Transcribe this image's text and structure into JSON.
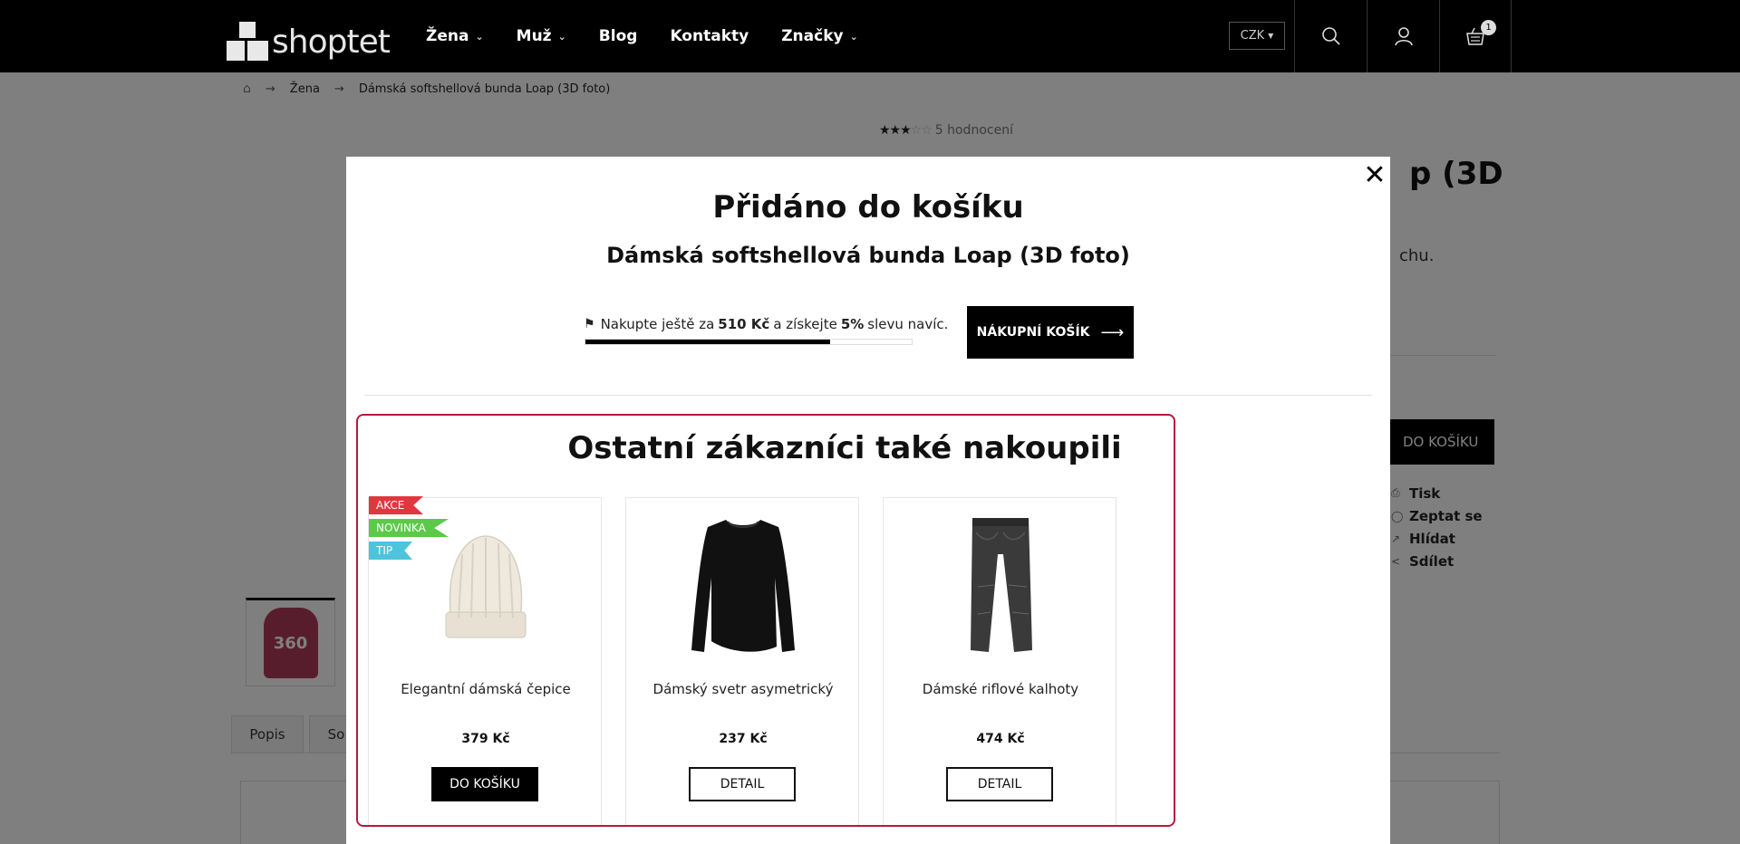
{
  "header": {
    "logo_text": "shoptet",
    "nav": [
      {
        "label": "Žena",
        "dropdown": true
      },
      {
        "label": "Muž",
        "dropdown": true
      },
      {
        "label": "Blog",
        "dropdown": false
      },
      {
        "label": "Kontakty",
        "dropdown": false
      },
      {
        "label": "Značky",
        "dropdown": true
      }
    ],
    "currency": "CZK",
    "cart_count": "1"
  },
  "breadcrumb": {
    "home_icon": "home-icon",
    "items": [
      "Žena",
      "Dámská softshellová bunda Loap (3D foto)"
    ]
  },
  "product": {
    "rating_text": "5 hodnocení",
    "rating_value": 3,
    "rating_max": 5,
    "title_fragment": "p (3D",
    "text_fragment": "chu.",
    "buy_label": "DO KOŠÍKU",
    "thumb_label": "360",
    "side_links": [
      "Tisk",
      "Zeptat se",
      "Hlídat",
      "Sdílet"
    ],
    "tabs": [
      "Popis",
      "So"
    ]
  },
  "modal": {
    "title": "Přidáno do košíku",
    "subtitle": "Dámská softshellová bunda Loap (3D foto)",
    "promo": {
      "prefix": "Nakupte ještě za",
      "amount": "510 Kč",
      "middle": "a získejte",
      "percent": "5%",
      "suffix": "slevu navíc.",
      "progress": 0.75
    },
    "cart_button": "NÁKUPNÍ KOŠÍK",
    "recommendations": {
      "title": "Ostatní zákazníci také nakoupili",
      "products": [
        {
          "name": "Elegantní dámská čepice",
          "price": "379 Kč",
          "button": "DO KOŠÍKU",
          "flags": [
            "AKCE",
            "NOVINKA",
            "TIP"
          ]
        },
        {
          "name": "Dámský svetr asymetrický",
          "price": "237 Kč",
          "button": "DETAIL",
          "flags": []
        },
        {
          "name": "Dámské riflové kalhoty",
          "price": "474 Kč",
          "button": "DETAIL",
          "flags": []
        }
      ]
    },
    "flag_colors": {
      "AKCE": "#e2363f",
      "NOVINKA": "#5cc94a",
      "TIP": "#4ec4dc"
    },
    "accent_color": "#b5193e"
  }
}
